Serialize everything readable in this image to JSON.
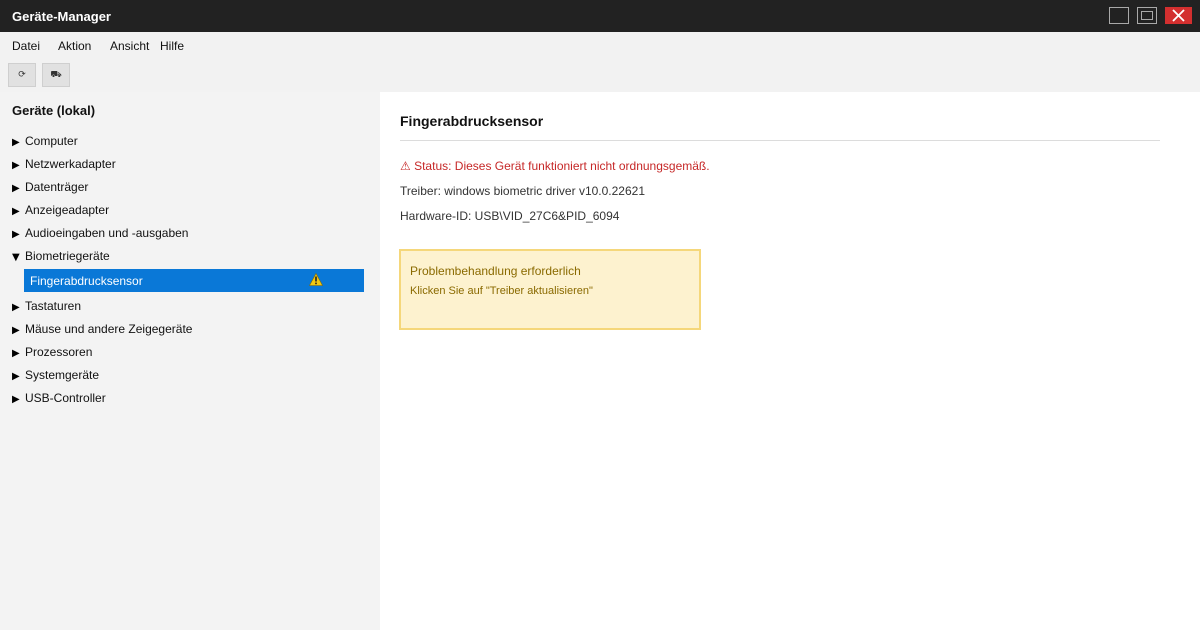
{
  "window": {
    "title": "Geräte-Manager"
  },
  "menu": {
    "items": [
      "Datei",
      "Aktion",
      "Ansicht",
      "Hilfe"
    ]
  },
  "toolbar": {
    "refresh_glyph": "⟳",
    "properties_glyph": "⛟"
  },
  "tree": {
    "root_label": "Geräte (lokal)",
    "collapsed_arrow": "▶",
    "expanded_arrow": "▼",
    "categories": [
      {
        "label": "Computer",
        "expanded": false
      },
      {
        "label": "Netzwerkadapter",
        "expanded": false
      },
      {
        "label": "Datenträger",
        "expanded": false
      },
      {
        "label": "Anzeigeadapter",
        "expanded": false
      },
      {
        "label": "Audioeingaben und -ausgaben",
        "expanded": false
      },
      {
        "label": "Biometriegeräte",
        "expanded": true
      },
      {
        "label": "Tastaturen",
        "expanded": false
      },
      {
        "label": "Mäuse und andere Zeigegeräte",
        "expanded": false
      },
      {
        "label": "Prozessoren",
        "expanded": false
      },
      {
        "label": "Systemgeräte",
        "expanded": false
      },
      {
        "label": "USB-Controller",
        "expanded": false
      }
    ],
    "selected_device": {
      "label": "Fingerabdrucksensor",
      "icon": "warning-icon"
    }
  },
  "details": {
    "title": "Fingerabdrucksensor",
    "status": "⚠ Status: Dieses Gerät funktioniert nicht ordnungsgemäß.",
    "driver": "Treiber: windows biometric driver v10.0.22621",
    "hardware_id": "Hardware-ID: USB\\VID_27C6&PID_6094"
  },
  "notice": {
    "title": "Problembehandlung erforderlich",
    "text": "Klicken Sie auf \"Treiber aktualisieren\""
  },
  "colors": {
    "titlebar": "#222222",
    "selection": "#0a78d7",
    "status_error": "#c62828",
    "notice_background": "#fdf2cf",
    "notice_border": "#f5d77a",
    "warning_yellow": "#f2c811",
    "close_button": "#d32f2f"
  }
}
